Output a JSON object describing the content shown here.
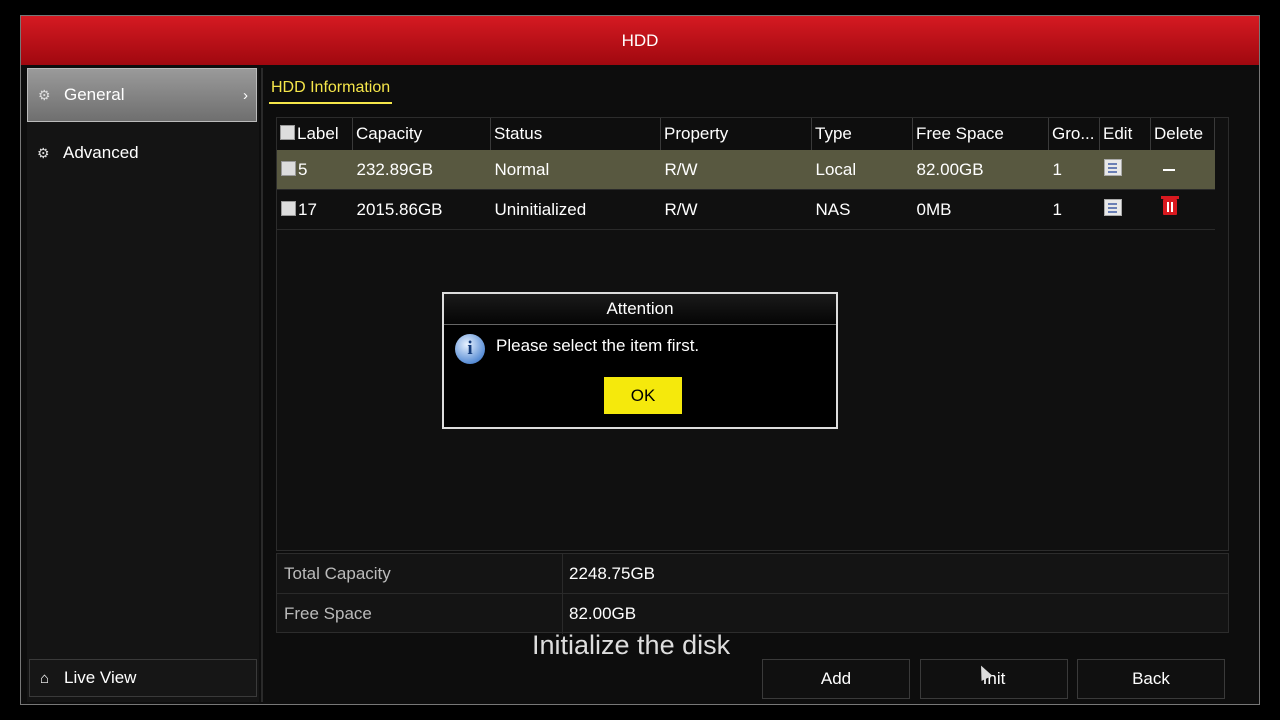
{
  "window": {
    "title": "HDD"
  },
  "sidebar": {
    "items": [
      {
        "label": "General",
        "icon": "gear-icon",
        "active": true
      },
      {
        "label": "Advanced",
        "icon": "gears-icon",
        "active": false
      }
    ],
    "live_view": {
      "label": "Live View",
      "icon": "home-icon"
    }
  },
  "tabs": [
    {
      "label": "HDD Information"
    }
  ],
  "table": {
    "columns": [
      "Label",
      "Capacity",
      "Status",
      "Property",
      "Type",
      "Free Space",
      "Gro...",
      "Edit",
      "Delete"
    ],
    "rows": [
      {
        "label": "5",
        "capacity": "232.89GB",
        "status": "Normal",
        "property": "R/W",
        "type": "Local",
        "free_space": "82.00GB",
        "group": "1",
        "edit_icon": "edit-icon",
        "delete_icon": "minus-icon",
        "selected": true
      },
      {
        "label": "17",
        "capacity": "2015.86GB",
        "status": "Uninitialized",
        "property": "R/W",
        "type": "NAS",
        "free_space": "0MB",
        "group": "1",
        "edit_icon": "edit-icon",
        "delete_icon": "trash-icon",
        "selected": false
      }
    ]
  },
  "summary": {
    "total_capacity_label": "Total Capacity",
    "total_capacity_value": "2248.75GB",
    "free_space_label": "Free Space",
    "free_space_value": "82.00GB"
  },
  "caption": "Initialize the disk",
  "buttons": {
    "add": "Add",
    "init": "Init",
    "back": "Back"
  },
  "dialog": {
    "title": "Attention",
    "message": "Please select the item first.",
    "ok": "OK",
    "icon": "info-icon"
  },
  "colors": {
    "accent": "#f5e64a",
    "titlebar": "#c8101a",
    "ok_button": "#f5e90c",
    "selected_row": "#585840"
  }
}
